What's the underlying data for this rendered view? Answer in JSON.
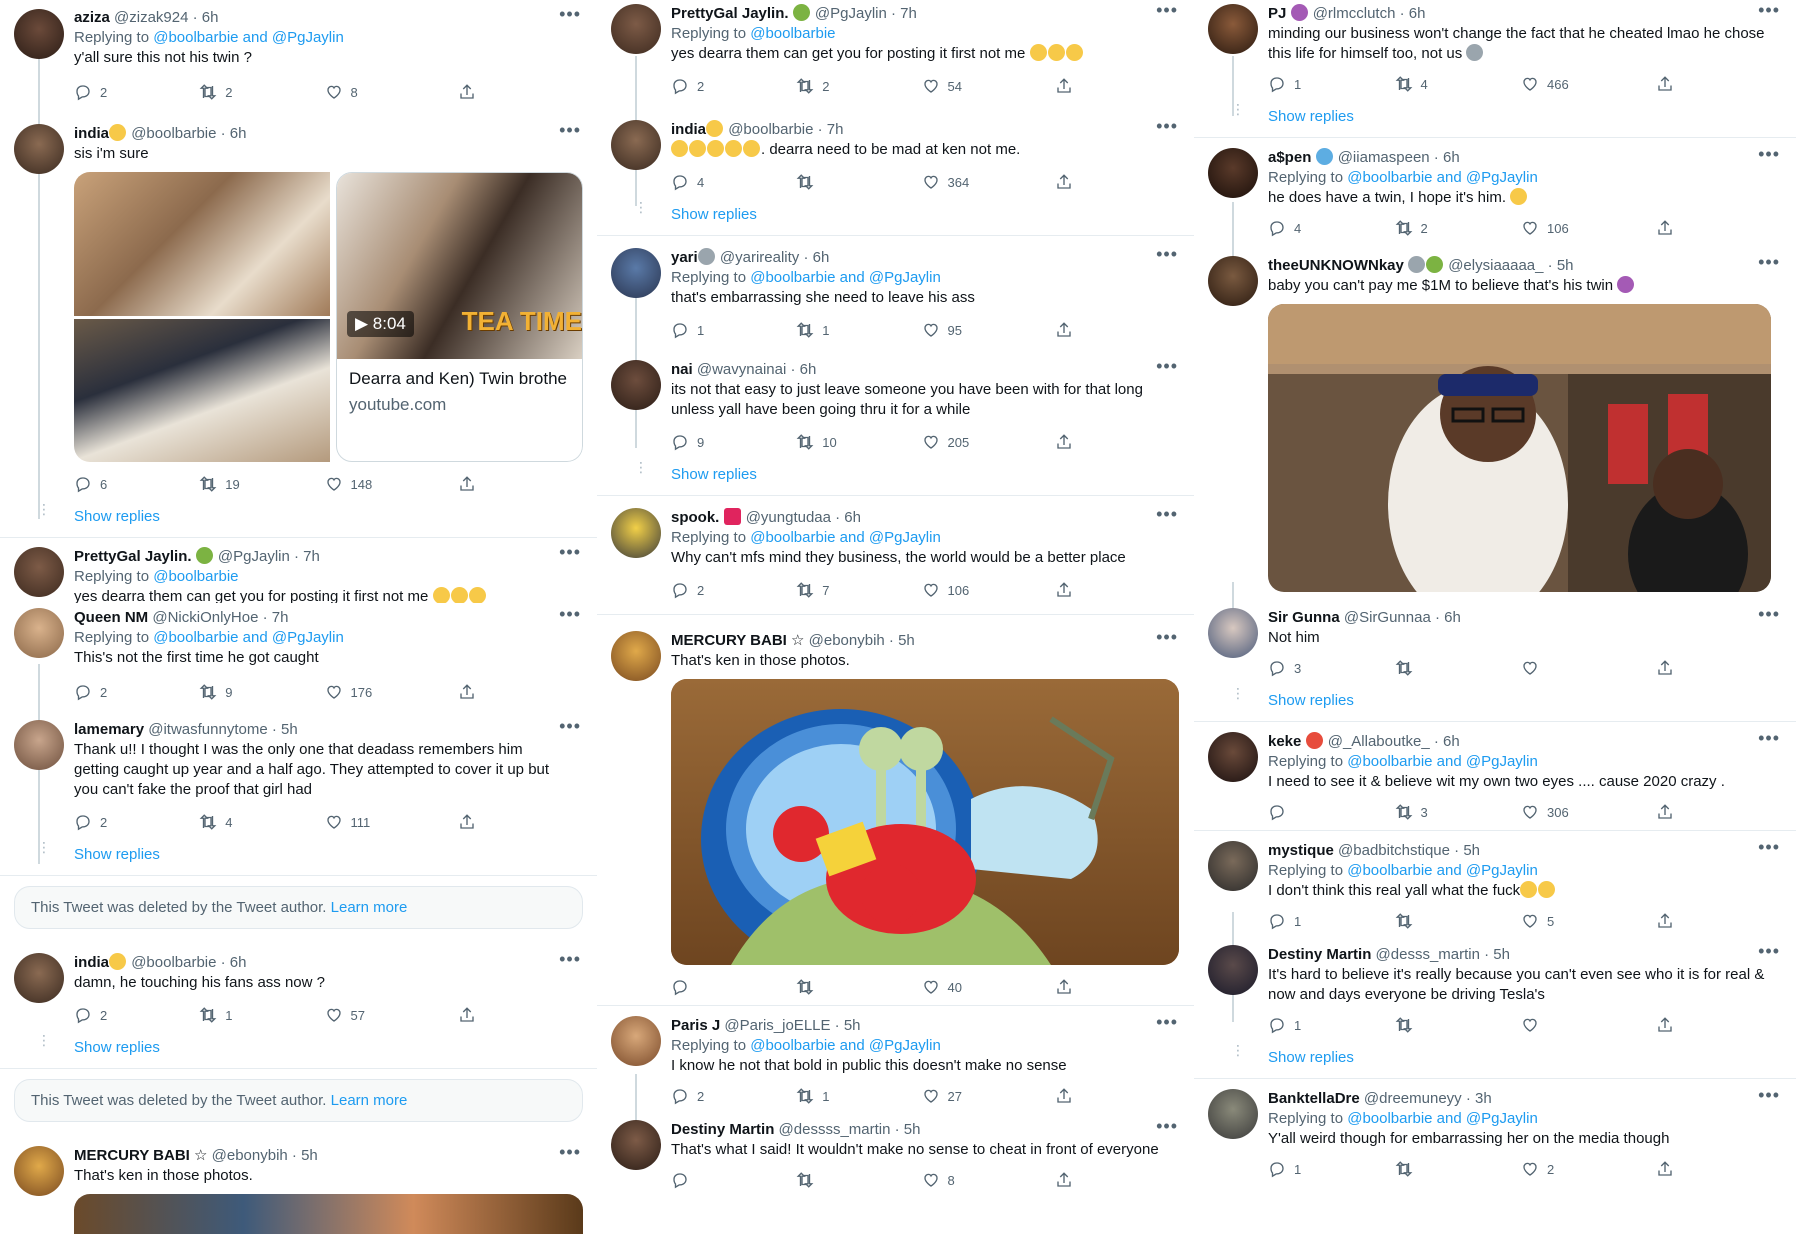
{
  "col1": {
    "t1": {
      "name": "aziza",
      "handle": "@zizak924 · 6h",
      "reply_prefix": "Replying to ",
      "reply_to": "@boolbarbie and @PgJaylin",
      "text": "y'all sure this not his twin ?",
      "replies": "2",
      "retweets": "2",
      "likes": "8"
    },
    "t2": {
      "name": "india",
      "handle": "@boolbarbie · 6h",
      "text": "sis i'm sure",
      "video_duration": "8:04",
      "video_overlay": "TEA TIME",
      "card_title": "Dearra and Ken) Twin brothe",
      "card_domain": "youtube.com",
      "replies": "6",
      "retweets": "19",
      "likes": "148"
    },
    "show_replies_1": "Show replies",
    "t3": {
      "name": "PrettyGal Jaylin.",
      "handle": "@PgJaylin · 7h",
      "reply_prefix": "Replying to ",
      "reply_to": "@boolbarbie",
      "text": "yes dearra them can get you for posting it first not me"
    },
    "t4": {
      "name": "Queen NM",
      "handle": "@NickiOnlyHoe · 7h",
      "reply_prefix": "Replying to ",
      "reply_to": "@boolbarbie and @PgJaylin",
      "text": "This's not the first time he got caught",
      "replies": "2",
      "retweets": "9",
      "likes": "176"
    },
    "t5": {
      "name": "lamemary",
      "handle": "@itwasfunnytome · 5h",
      "text": "Thank u!! I thought I was the only one that deadass remembers him getting caught up  year and a half ago. They attempted to cover it up but you can't fake the proof that girl had",
      "replies": "2",
      "retweets": "4",
      "likes": "111"
    },
    "show_replies_2": "Show replies",
    "deleted_1": {
      "text": "This Tweet was deleted by the Tweet author. ",
      "link": "Learn more"
    },
    "t6": {
      "name": "india",
      "handle": "@boolbarbie · 6h",
      "text": "damn, he touching his fans ass now ?",
      "replies": "2",
      "retweets": "1",
      "likes": "57"
    },
    "show_replies_3": "Show replies",
    "deleted_2": {
      "text": "This Tweet was deleted by the Tweet author. ",
      "link": "Learn more"
    },
    "t7": {
      "name": "MERCURY BABI ☆",
      "handle": "@ebonybih · 5h",
      "text": "That's ken in those photos."
    }
  },
  "col2": {
    "t1": {
      "name": "PrettyGal Jaylin.",
      "handle": "@PgJaylin · 7h",
      "reply_prefix": "Replying to ",
      "reply_to": "@boolbarbie",
      "text": "yes dearra them can get you for posting it first not me",
      "replies": "2",
      "retweets": "2",
      "likes": "54"
    },
    "t2": {
      "name": "india",
      "handle": "@boolbarbie · 7h",
      "text": ". dearra need to be mad at ken not me.",
      "replies": "4",
      "retweets": "",
      "likes": "364"
    },
    "show_replies_1": "Show replies",
    "t3": {
      "name": "yari",
      "handle": "@yarireality · 6h",
      "reply_prefix": "Replying to ",
      "reply_to": "@boolbarbie and @PgJaylin",
      "text": "that's embarrassing she need to leave his ass",
      "replies": "1",
      "retweets": "1",
      "likes": "95"
    },
    "t4": {
      "name": "nai",
      "handle": "@wavynainai · 6h",
      "text": "its not that easy to just leave someone you have been with for that long unless yall have been going thru it for a while",
      "replies": "9",
      "retweets": "10",
      "likes": "205"
    },
    "show_replies_2": "Show replies",
    "t5": {
      "name": "spook.",
      "handle": "@yungtudaa · 6h",
      "reply_prefix": "Replying to ",
      "reply_to": "@boolbarbie and @PgJaylin",
      "text": "Why can't mfs mind they business, the world would be a better place",
      "replies": "2",
      "retweets": "7",
      "likes": "106"
    },
    "t6": {
      "name": "MERCURY BABI ☆",
      "handle": "@ebonybih · 5h",
      "text": "That's ken in those photos.",
      "replies": "",
      "retweets": "",
      "likes": "40"
    },
    "t7": {
      "name": "Paris J",
      "handle": "@Paris_joELLE · 5h",
      "reply_prefix": "Replying to ",
      "reply_to": "@boolbarbie and @PgJaylin",
      "text": "I know he not that bold in public this doesn't make no sense",
      "replies": "2",
      "retweets": "1",
      "likes": "27"
    },
    "t8": {
      "name": "Destiny Martin",
      "handle": "@dessss_martin · 5h",
      "text": "That's what I said! It wouldn't make no sense to cheat in front of everyone",
      "replies": "",
      "retweets": "",
      "likes": "8"
    }
  },
  "col3": {
    "t1": {
      "name": "PJ",
      "handle": "@rlmcclutch · 6h",
      "text": "minding our business won't change the fact that he cheated lmao he chose this life for himself too, not us",
      "replies": "1",
      "retweets": "4",
      "likes": "466"
    },
    "show_replies_1": "Show replies",
    "t2": {
      "name": "a$pen",
      "handle": "@iiamaspeen · 6h",
      "reply_prefix": "Replying to ",
      "reply_to": "@boolbarbie and @PgJaylin",
      "text": "he does have a twin, I hope it's him.",
      "replies": "4",
      "retweets": "2",
      "likes": "106"
    },
    "t3": {
      "name": "theeUNKNOWNkay",
      "handle": "@elysiaaaaa_ · 5h",
      "text": "baby you can't pay me $1M to believe that's his twin"
    },
    "t4": {
      "name": "Sir Gunna",
      "handle": "@SirGunnaa · 6h",
      "text": "Not him",
      "replies": "3",
      "retweets": "",
      "likes": ""
    },
    "show_replies_2": "Show replies",
    "t5": {
      "name": "keke",
      "handle": "@_Allaboutke_ · 6h",
      "reply_prefix": "Replying to ",
      "reply_to": "@boolbarbie and @PgJaylin",
      "text": "I need to see it & believe wit my own two eyes .... cause 2020 crazy .",
      "replies": "",
      "retweets": "3",
      "likes": "306"
    },
    "t6": {
      "name": "mystique",
      "handle": "@badbitchstique · 5h",
      "reply_prefix": "Replying to ",
      "reply_to": "@boolbarbie and @PgJaylin",
      "text": "I don't think this real yall what the fuck",
      "replies": "1",
      "retweets": "",
      "likes": "5"
    },
    "t7": {
      "name": "Destiny Martin",
      "handle": "@desss_martin · 5h",
      "text": "It's hard to believe it's really because you can't even see who it is for real & now and days everyone be driving Tesla's",
      "replies": "1",
      "retweets": "",
      "likes": ""
    },
    "show_replies_3": "Show replies",
    "t8": {
      "name": "BanktellaDre",
      "handle": "@dreemuneyy · 3h",
      "reply_prefix": "Replying to ",
      "reply_to": "@boolbarbie and @PgJaylin",
      "text": "Y'all weird though for embarrassing her on the media though",
      "replies": "1",
      "retweets": "",
      "likes": "2"
    }
  },
  "icons": {
    "more": "more-icon",
    "reply": "reply-icon",
    "retweet": "retweet-icon",
    "like": "like-icon",
    "share": "share-icon"
  },
  "colors": {
    "link": "#1d9bf0",
    "muted": "#536471",
    "border": "#e6ecf0"
  }
}
